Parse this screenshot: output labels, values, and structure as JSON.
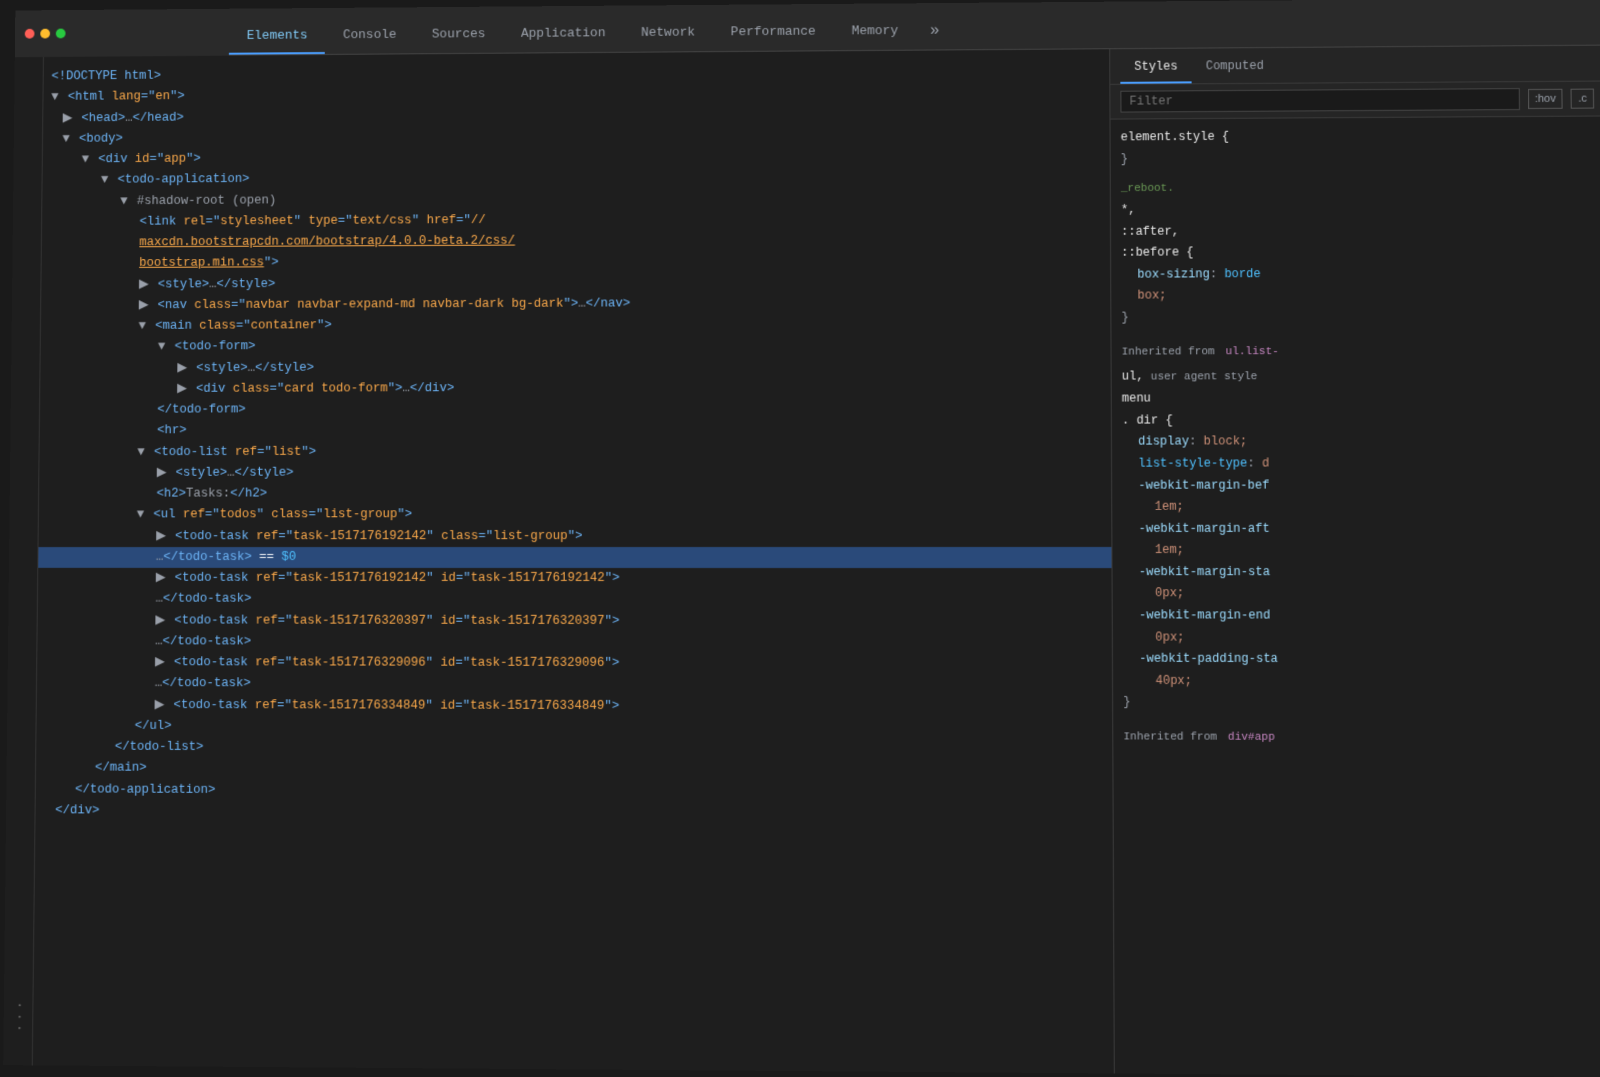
{
  "tabs": {
    "items": [
      {
        "label": "Elements",
        "active": true
      },
      {
        "label": "Console",
        "active": false
      },
      {
        "label": "Sources",
        "active": false
      },
      {
        "label": "Application",
        "active": false
      },
      {
        "label": "Network",
        "active": false
      },
      {
        "label": "Performance",
        "active": false
      },
      {
        "label": "Memory",
        "active": false
      },
      {
        "label": "»",
        "active": false
      }
    ]
  },
  "styles_tabs": {
    "items": [
      {
        "label": "Styles",
        "active": true
      },
      {
        "label": "Computed",
        "active": false
      }
    ]
  },
  "filter": {
    "placeholder": "Filter",
    "hov_label": ":hov",
    "cls_label": ".c"
  },
  "dom": {
    "lines": [
      {
        "indent": 0,
        "content": "<!DOCTYPE html>"
      },
      {
        "indent": 0,
        "content": "<html lang=\"en\">"
      },
      {
        "indent": 1,
        "content": "<head>…</head>"
      },
      {
        "indent": 1,
        "content": "<body>"
      },
      {
        "indent": 2,
        "content": "<div id=\"app\">"
      },
      {
        "indent": 3,
        "content": "<todo-application>"
      },
      {
        "indent": 4,
        "content": "#shadow-root (open)"
      },
      {
        "indent": 5,
        "content": "<link rel=\"stylesheet\" type=\"text/css\" href=\"//"
      },
      {
        "indent": 5,
        "content": "maxcdn.bootstrapcdn.com/bootstrap/4.0.0-beta.2/css/"
      },
      {
        "indent": 5,
        "content": "bootstrap.min.css\">"
      },
      {
        "indent": 5,
        "content": "<style>…</style>"
      },
      {
        "indent": 5,
        "content": "<nav class=\"navbar navbar-expand-md navbar-dark bg-dark\">…</nav>"
      },
      {
        "indent": 5,
        "content": "<main class=\"container\">"
      },
      {
        "indent": 6,
        "content": "<todo-form>"
      },
      {
        "indent": 7,
        "content": "<style>…</style>"
      },
      {
        "indent": 7,
        "content": "<div class=\"card todo-form\">…</div>"
      },
      {
        "indent": 6,
        "content": "</todo-form>"
      },
      {
        "indent": 6,
        "content": "<hr>"
      },
      {
        "indent": 5,
        "content": "<todo-list ref=\"list\">"
      },
      {
        "indent": 6,
        "content": "<style>…</style>"
      },
      {
        "indent": 6,
        "content": "<h2>Tasks:</h2>"
      },
      {
        "indent": 5,
        "content": "<ul ref=\"todos\" class=\"list-group\">"
      },
      {
        "indent": 6,
        "content": "<todo-task ref=\"task-1517176192142\" class=\"list-group\">"
      },
      {
        "indent": 6,
        "content": "…</todo-task> == $0"
      },
      {
        "indent": 6,
        "content": "<todo-task ref=\"task-1517176192142\" id=\"task-1517176192142\">"
      },
      {
        "indent": 6,
        "content": "…</todo-task>"
      },
      {
        "indent": 6,
        "content": "<todo-task ref=\"task-1517176320397\" id=\"task-1517176320397\">"
      },
      {
        "indent": 6,
        "content": "…</todo-task>"
      },
      {
        "indent": 6,
        "content": "<todo-task ref=\"task-1517176329096\" id=\"task-1517176329096\">"
      },
      {
        "indent": 6,
        "content": "…</todo-task>"
      },
      {
        "indent": 6,
        "content": "<todo-task ref=\"task-1517176334849\" id=\"task-1517176334849\">"
      },
      {
        "indent": 5,
        "content": "</ul>"
      },
      {
        "indent": 4,
        "content": "</todo-list>"
      },
      {
        "indent": 3,
        "content": "</main>"
      },
      {
        "indent": 2,
        "content": "</todo-application>"
      },
      {
        "indent": 1,
        "content": "</div>"
      }
    ]
  },
  "styles": {
    "element_style": {
      "selector": "element.style {",
      "close": "}"
    },
    "universal": {
      "selector": "*, ::after, ::before {",
      "source": "_reboot.",
      "props": [
        {
          "name": "box-sizing",
          "value": "borde"
        },
        {
          "name": "",
          "value": "box;"
        }
      ],
      "close": "}"
    },
    "inherited_label": "Inherited from",
    "inherited_source": "ul.list-",
    "inherited_rules": [
      {
        "selector": "ul, user agent style",
        "close": ""
      },
      {
        "selector": "menu",
        "close": ""
      },
      {
        "selector": ". dir {",
        "close": ""
      },
      {
        "prop": "display",
        "value": "block;"
      },
      {
        "prop": "list-style-type",
        "value": "d"
      },
      {
        "prop": "-webkit-margin-bef",
        "value": "1em;"
      },
      {
        "prop": "-webkit-margin-aft",
        "value": "1em;"
      },
      {
        "prop": "-webkit-margin-sta",
        "value": "0px;"
      },
      {
        "prop": "-webkit-margin-end",
        "value": "0px;"
      },
      {
        "prop": "-webkit-padding-sta",
        "value": "40px;"
      }
    ],
    "inherited_from2_label": "Inherited from",
    "inherited_from2_source": "div#app"
  }
}
